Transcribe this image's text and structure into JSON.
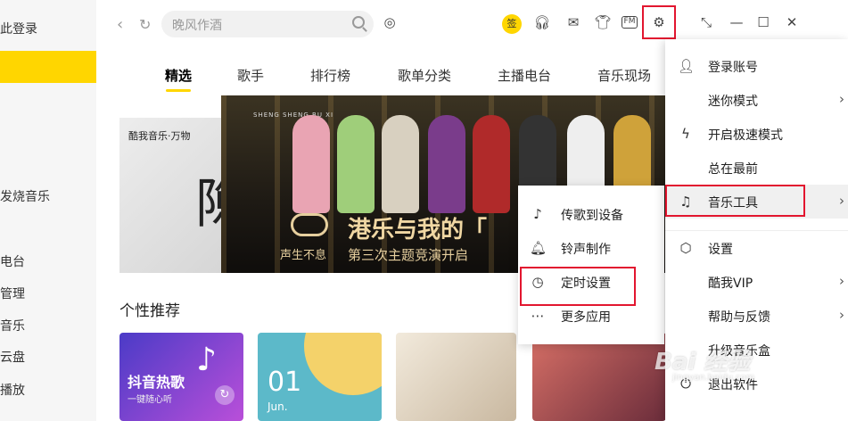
{
  "sidebar": {
    "items": [
      "此登录",
      "发烧音乐",
      "电台",
      "管理",
      "音乐",
      "云盘",
      "播放"
    ]
  },
  "topbar": {
    "search_placeholder": "晚风作酒",
    "sign_label": "签",
    "fm_label": "FM"
  },
  "tabs": [
    "精选",
    "歌手",
    "排行榜",
    "歌单分类",
    "主播电台",
    "音乐现场"
  ],
  "banner": {
    "left_logo": "酷我音乐·万物",
    "left_char": "隙",
    "main_mini": "SHENG SHENG BU XI",
    "main_title": "港乐与我的「",
    "main_sub": "第三次主题竞演开启",
    "main_brand": "声生不息"
  },
  "section": {
    "title": "个性推荐",
    "cards": {
      "c1_title": "抖音热歌",
      "c1_sub": "一键随心听",
      "c2_day": "01",
      "c2_month": "Jun."
    }
  },
  "menu": {
    "items": [
      {
        "icon": "user-icon",
        "label": "登录账号"
      },
      {
        "icon": "",
        "label": "迷你模式"
      },
      {
        "icon": "lightning-icon",
        "label": "开启极速模式"
      },
      {
        "icon": "",
        "label": "总在最前"
      },
      {
        "icon": "music-tool-icon",
        "label": "音乐工具"
      },
      {
        "icon": "settings-icon",
        "label": "设置"
      },
      {
        "icon": "",
        "label": "酷我VIP"
      },
      {
        "icon": "",
        "label": "帮助与反馈"
      },
      {
        "icon": "",
        "label": "升级音乐盒"
      },
      {
        "icon": "power-icon",
        "label": "退出软件"
      }
    ]
  },
  "submenu": {
    "items": [
      {
        "icon": "device-music-icon",
        "label": "传歌到设备"
      },
      {
        "icon": "bell-icon",
        "label": "铃声制作"
      },
      {
        "icon": "timer-icon",
        "label": "定时设置"
      },
      {
        "icon": "more-icon",
        "label": "更多应用"
      }
    ]
  },
  "watermark": {
    "text": "Bai 经验",
    "sub": "jingyan.baidu.com"
  },
  "colors": {
    "accent": "#ffd600",
    "highlight_box": "#e2162f"
  }
}
